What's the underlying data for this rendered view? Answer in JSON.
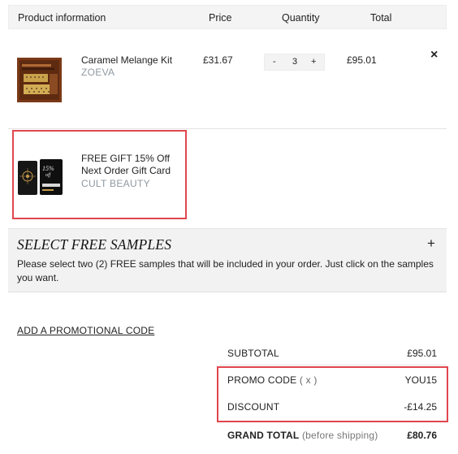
{
  "table_header": {
    "product": "Product information",
    "price": "Price",
    "quantity": "Quantity",
    "total": "Total"
  },
  "items": [
    {
      "name": "Caramel Melange Kit",
      "brand": "ZOEVA",
      "price": "£31.67",
      "quantity": "3",
      "total": "£95.01",
      "qty_minus": "-",
      "qty_plus": "+",
      "remove": "×"
    },
    {
      "name_line1": "FREE GIFT 15% Off",
      "name_line2": "Next Order Gift Card",
      "brand": "CULT BEAUTY"
    }
  ],
  "samples": {
    "title": "Select Free Samples",
    "toggle": "+",
    "description": "Please select two (2) FREE samples that will be included in your order. Just click on the samples you want."
  },
  "promo_link": "ADD A PROMOTIONAL CODE",
  "summary": {
    "subtotal_label": "SUBTOTAL",
    "subtotal_value": "£95.01",
    "promo_label": "PROMO CODE",
    "promo_remove": "( x )",
    "promo_value": "YOU15",
    "discount_label": "DISCOUNT",
    "discount_value": "-£14.25",
    "grand_total_label": "GRAND TOTAL",
    "grand_total_note": "(before shipping)",
    "grand_total_value": "£80.76"
  },
  "colors": {
    "highlight": "#e0464e",
    "brand_text": "#8f99a1",
    "section_bg": "#f2f2f2"
  }
}
